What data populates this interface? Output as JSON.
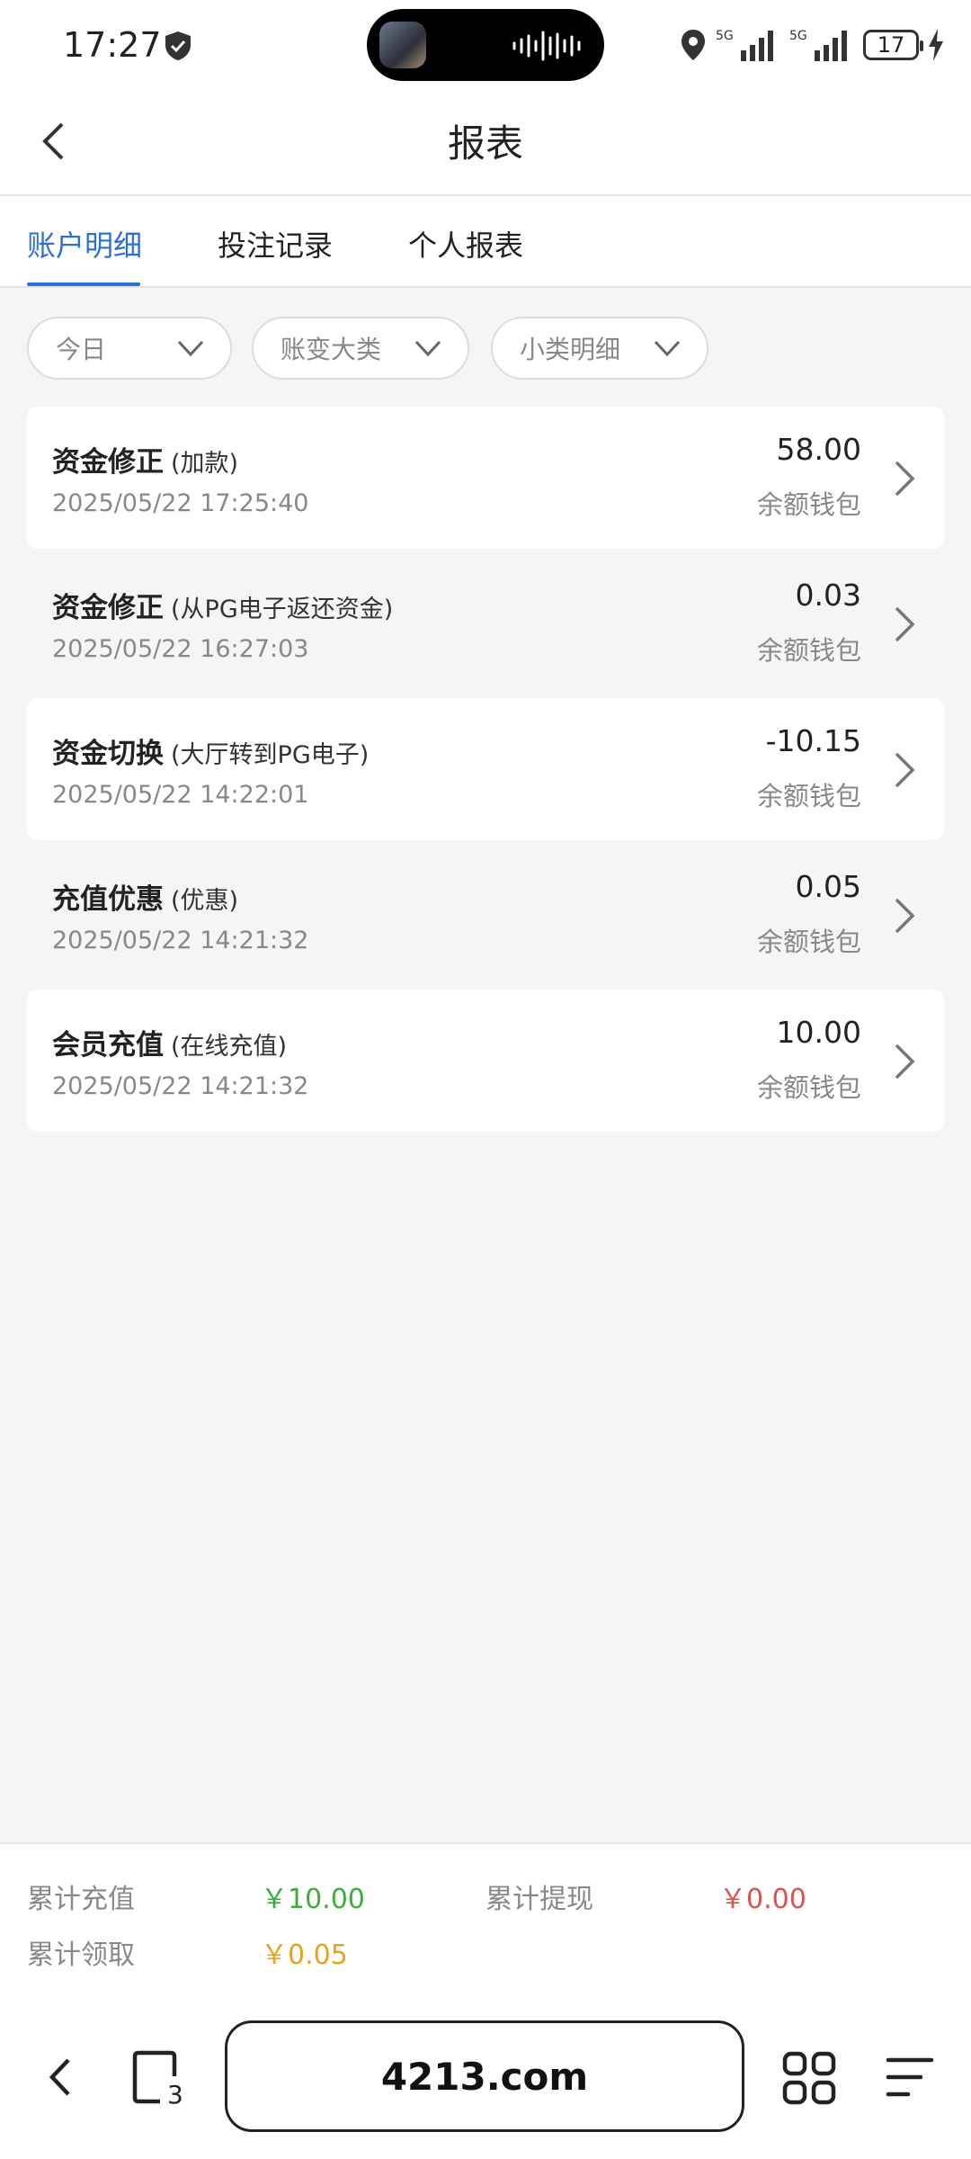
{
  "status_bar": {
    "time": "17:27",
    "battery": "17",
    "signal_label_1": "5G",
    "signal_label_2": "5G"
  },
  "header": {
    "title": "报表"
  },
  "tabs": [
    {
      "label": "账户明细",
      "active": true
    },
    {
      "label": "投注记录",
      "active": false
    },
    {
      "label": "个人报表",
      "active": false
    }
  ],
  "filters": [
    {
      "label": "今日"
    },
    {
      "label": "账变大类"
    },
    {
      "label": "小类明细"
    }
  ],
  "records": [
    {
      "title": "资金修正",
      "subtitle": "(加款)",
      "date": "2025/05/22 17:25:40",
      "amount": "58.00",
      "wallet": "余额钱包"
    },
    {
      "title": "资金修正",
      "subtitle": "(从PG电子返还资金)",
      "date": "2025/05/22 16:27:03",
      "amount": "0.03",
      "wallet": "余额钱包"
    },
    {
      "title": "资金切换",
      "subtitle": "(大厅转到PG电子)",
      "date": "2025/05/22 14:22:01",
      "amount": "-10.15",
      "wallet": "余额钱包"
    },
    {
      "title": "充值优惠",
      "subtitle": "(优惠)",
      "date": "2025/05/22 14:21:32",
      "amount": "0.05",
      "wallet": "余额钱包"
    },
    {
      "title": "会员充值",
      "subtitle": "(在线充值)",
      "date": "2025/05/22 14:21:32",
      "amount": "10.00",
      "wallet": "余额钱包"
    }
  ],
  "summary": {
    "total_deposit_label": "累计充值",
    "total_deposit_value": "￥10.00",
    "total_withdraw_label": "累计提现",
    "total_withdraw_value": "￥0.00",
    "total_claim_label": "累计领取",
    "total_claim_value": "￥0.05"
  },
  "browser": {
    "url": "4213.com",
    "tab_count": "3"
  },
  "colors": {
    "accent": "#2c6fd6",
    "deposit": "#3aae3a",
    "withdraw": "#d9534f",
    "claim": "#e8a21c"
  }
}
